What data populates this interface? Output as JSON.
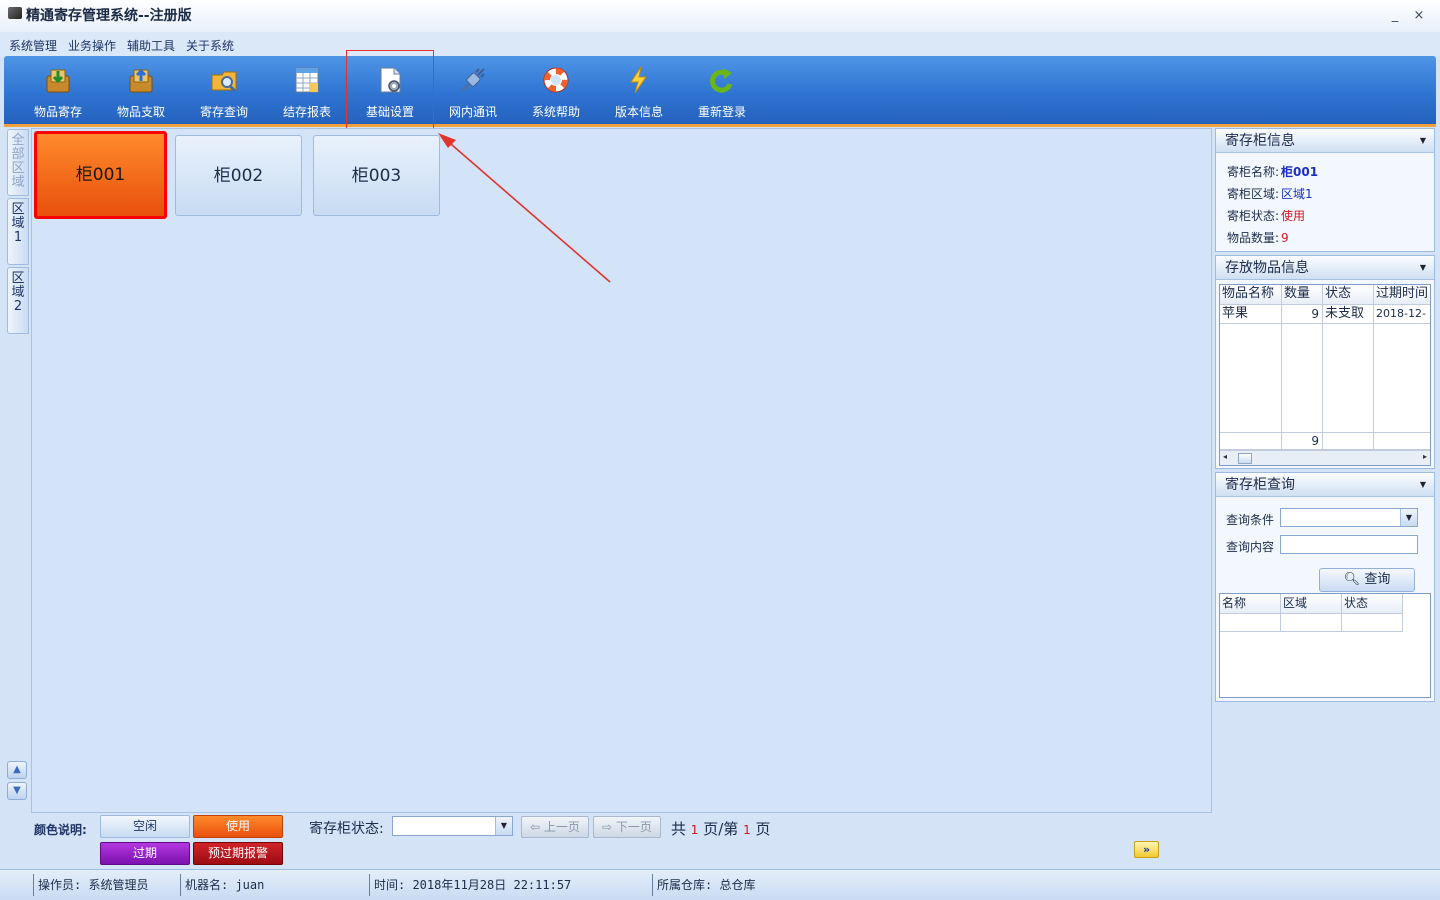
{
  "window": {
    "title": "精通寄存管理系统--注册版",
    "minimize": "_",
    "close": "×"
  },
  "menu": [
    "系统管理",
    "业务操作",
    "辅助工具",
    "关于系统"
  ],
  "toolbar": [
    {
      "label": "物品寄存",
      "icon": "deposit-icon"
    },
    {
      "label": "物品支取",
      "icon": "withdraw-icon"
    },
    {
      "label": "寄存查询",
      "icon": "query-icon"
    },
    {
      "label": "结存报表",
      "icon": "report-icon"
    },
    {
      "label": "基础设置",
      "icon": "settings-icon"
    },
    {
      "label": "网内通讯",
      "icon": "network-icon"
    },
    {
      "label": "系统帮助",
      "icon": "help-icon"
    },
    {
      "label": "版本信息",
      "icon": "version-icon"
    },
    {
      "label": "重新登录",
      "icon": "relogin-icon"
    }
  ],
  "area_tabs": [
    "全部区域",
    "区域1",
    "区域2"
  ],
  "lockers": [
    {
      "label": "柜001",
      "state": "used"
    },
    {
      "label": "柜002",
      "state": "idle"
    },
    {
      "label": "柜003",
      "state": "idle"
    }
  ],
  "legend": {
    "title": "颜色说明:",
    "idle": "空闲",
    "used": "使用",
    "expired": "过期",
    "warning": "预过期报警"
  },
  "filter": {
    "label": "寄存柜状态:",
    "value": ""
  },
  "pager": {
    "prev": "上一页",
    "next": "下一页",
    "total_prefix": "共",
    "total": "1",
    "page_sep": "页/第",
    "current": "1",
    "suffix": "页"
  },
  "expand_button": "»",
  "status_bar": {
    "operator": "操作员: 系统管理员",
    "machine": "机器名: juan",
    "time": "时间: 2018年11月28日 22:11:57",
    "warehouse": "所属仓库: 总仓库"
  },
  "locker_info": {
    "title": "寄存柜信息",
    "rows": [
      {
        "label": "寄柜名称:",
        "value": "柜001",
        "color": "#1a2fc0"
      },
      {
        "label": "寄柜区域:",
        "value": "区域1",
        "color": "#1a2fc0"
      },
      {
        "label": "寄柜状态:",
        "value": "使用",
        "color": "#d4161c"
      },
      {
        "label": "物品数量:",
        "value": "9",
        "color": "#d4161c"
      }
    ]
  },
  "item_info": {
    "title": "存放物品信息",
    "columns": [
      "物品名称",
      "数量",
      "状态",
      "过期时间"
    ],
    "rows": [
      [
        "苹果",
        "9",
        "未支取",
        "2018-12-"
      ]
    ],
    "footer": [
      "",
      "9",
      "",
      ""
    ]
  },
  "locker_query": {
    "title": "寄存柜查询",
    "condition_label": "查询条件",
    "content_label": "查询内容",
    "button": "查询",
    "columns": [
      "名称",
      "区域",
      "状态"
    ]
  }
}
